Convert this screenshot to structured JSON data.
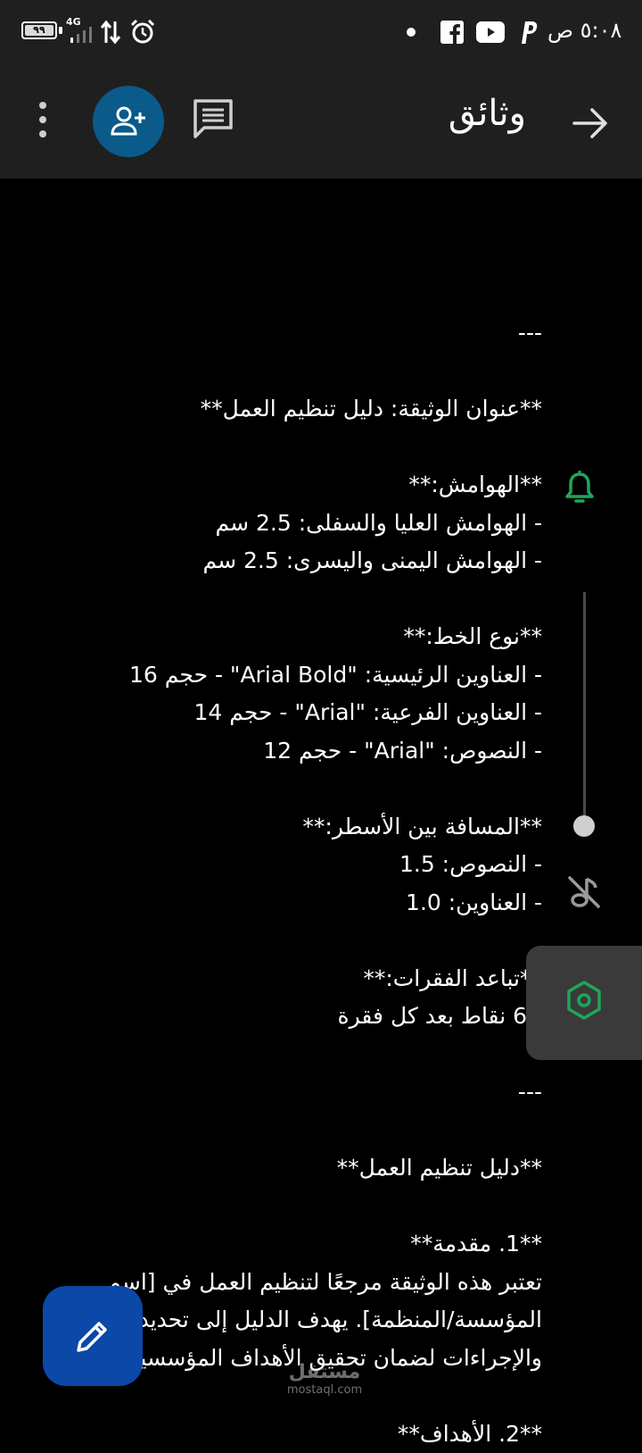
{
  "status_bar": {
    "battery": "٩٩",
    "battery_level_percent": 99,
    "network": "4G",
    "clock": "٥:٠٨ ص",
    "icons": [
      "battery-icon",
      "signal-icon",
      "data-arrows-icon",
      "alarm-icon",
      "notification-dot-icon",
      "facebook-icon",
      "youtube-icon",
      "paypal-icon"
    ]
  },
  "app_bar": {
    "title": "وثائق",
    "icons": [
      "more-vert-icon",
      "add-user-icon",
      "comment-icon",
      "arrow-forward-icon"
    ]
  },
  "document": {
    "lines": [
      "---",
      "",
      "**عنوان الوثيقة: دليل تنظيم العمل**",
      "",
      "**الهوامش:**",
      "- الهوامش العليا والسفلى: 2.5 سم",
      "- الهوامش اليمنى واليسرى: 2.5 سم",
      "",
      "**نوع الخط:**",
      "- العناوين الرئيسية: \"Arial Bold\" - حجم 16",
      "- العناوين الفرعية: \"Arial\" - حجم 14",
      "- النصوص: \"Arial\" - حجم 12",
      "",
      "**المسافة بين الأسطر:**",
      "- النصوص: 1.5",
      "- العناوين: 1.0",
      "",
      "**تباعد الفقرات:**",
      "- 6 نقاط بعد كل فقرة",
      "",
      "---",
      "",
      "**دليل تنظيم العمل**",
      "",
      "**1. مقدمة**",
      "تعتبر هذه الوثيقة مرجعًا لتنظيم العمل في [اسم",
      "المؤسسة/المنظمة]. يهدف الدليل إلى تحديد",
      "والإجراءات لضمان تحقيق الأهداف المؤسسية.",
      "",
      "**2. الأهداف**"
    ]
  },
  "side_rail": {
    "icons": [
      "bell-icon",
      "mute-icon",
      "settings-hexagon-icon"
    ],
    "slider_level": 1.0
  },
  "fab": {
    "icon": "edit-pencil-icon"
  },
  "watermark": {
    "arabic": "مستقل",
    "latin": "mostaql.com"
  },
  "colors": {
    "status_bar_bg": "#1f1f1f",
    "doc_bg": "#000000",
    "accent_green": "#1fa55a",
    "add_user_bg": "#0a5a8a",
    "fab_bg": "#0b48a8",
    "settings_panel_bg": "#3a3a3a"
  }
}
